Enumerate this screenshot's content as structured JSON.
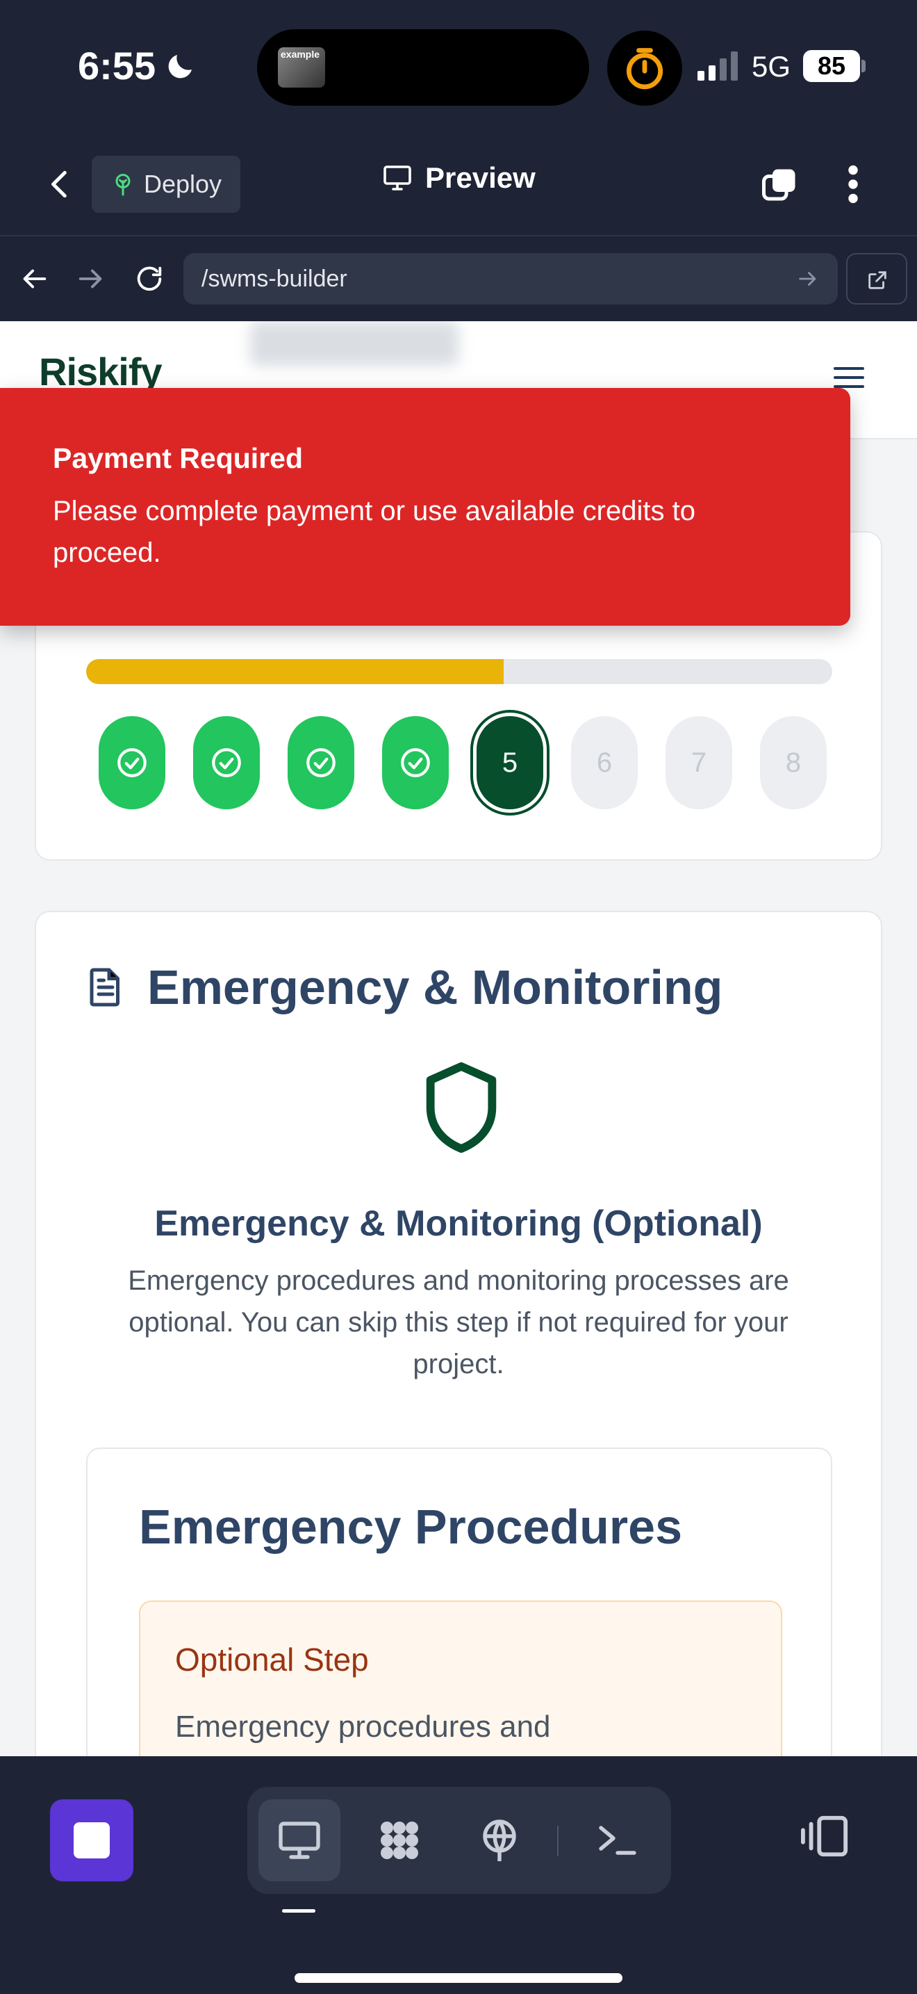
{
  "status_bar": {
    "time": "6:55",
    "island_thumb_text": "example",
    "network": "5G",
    "battery": "85"
  },
  "toolbar": {
    "deploy_label": "Deploy",
    "preview_label": "Preview"
  },
  "browser": {
    "url": "/swms-builder"
  },
  "site": {
    "logo_text": "Riskify"
  },
  "toast": {
    "title": "Payment Required",
    "message": "Please complete payment or use available credits to proceed."
  },
  "progress": {
    "fraction": 0.56,
    "current_step": 5,
    "steps": [
      {
        "label": "",
        "state": "done"
      },
      {
        "label": "",
        "state": "done"
      },
      {
        "label": "",
        "state": "done"
      },
      {
        "label": "",
        "state": "done"
      },
      {
        "label": "5",
        "state": "current"
      },
      {
        "label": "6",
        "state": "todo"
      },
      {
        "label": "7",
        "state": "todo"
      },
      {
        "label": "8",
        "state": "todo"
      }
    ]
  },
  "main": {
    "section_title": "Emergency & Monitoring",
    "sub_title": "Emergency & Monitoring (Optional)",
    "description": "Emergency procedures and monitoring processes are optional. You can skip this step if not required for your project.",
    "inner_title": "Emergency Procedures",
    "optional_title": "Optional Step",
    "optional_text": "Emergency procedures and"
  },
  "colors": {
    "accent_green": "#22c55e",
    "brand_dark_green": "#064e2c",
    "progress_yellow": "#eab308",
    "toast_red": "#dc2626",
    "stop_purple": "#5b35d5"
  },
  "icons": [
    "moon-icon",
    "timer-icon",
    "back-chevron-icon",
    "deploy-tree-icon",
    "monitor-icon",
    "tabs-icon",
    "more-vertical-icon",
    "arrow-left-icon",
    "arrow-right-icon",
    "reload-icon",
    "arrow-go-icon",
    "external-link-icon",
    "hamburger-icon",
    "check-icon",
    "document-icon",
    "shield-icon",
    "stop-icon",
    "desktop-icon",
    "apps-icon",
    "globe-icon",
    "terminal-icon",
    "panel-icon"
  ]
}
